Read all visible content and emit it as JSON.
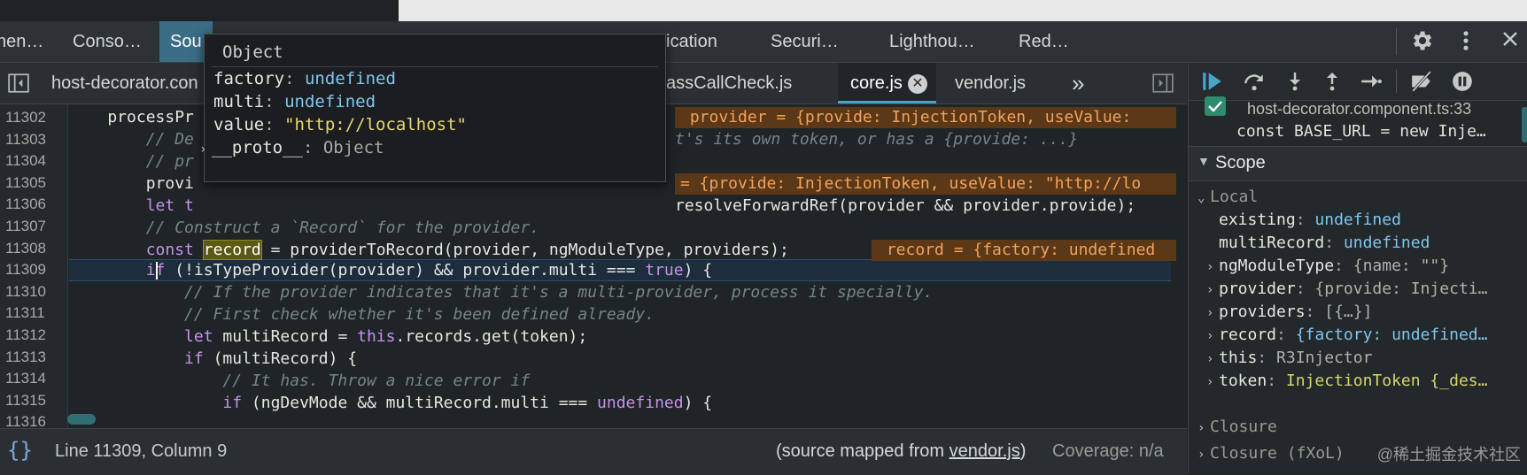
{
  "devtools_tabs": [
    "nen…",
    "Conso…",
    "Sou",
    "ication",
    "Securi…",
    "Lighthou…",
    "Red…"
  ],
  "file_tabs": {
    "left": "host-decorator.con",
    "middle": "assCallCheck.js",
    "active": "core.js",
    "next": "vendor.js",
    "more": "»"
  },
  "tooltip": {
    "title": "Object",
    "rows": [
      {
        "key": "factory",
        "value": "undefined"
      },
      {
        "key": "multi",
        "value": "undefined"
      },
      {
        "key": "value",
        "value": "\"http://localhost\""
      },
      {
        "key": "__proto__",
        "value": "Object"
      }
    ]
  },
  "code": {
    "line_numbers": [
      "11302",
      "11303",
      "11304",
      "11305",
      "11306",
      "11307",
      "11308",
      "11309",
      "11310",
      "11311",
      "11312",
      "11313",
      "11314",
      "11315",
      "11316"
    ],
    "lines": [
      {
        "kind": "plain",
        "text": "    processPr"
      },
      {
        "kind": "comment",
        "text": "        // De"
      },
      {
        "kind": "comment",
        "text": "        // pr"
      },
      {
        "kind": "plain",
        "text": "        provi"
      },
      {
        "kind": "plain",
        "text": "        let t"
      },
      {
        "kind": "comment",
        "text": "        // Construct a `Record` for the provider."
      },
      {
        "kind": "record",
        "text": ""
      },
      {
        "kind": "current",
        "text": ""
      },
      {
        "kind": "comment",
        "text": "            // If the provider indicates that it's a multi-provider, process it specially."
      },
      {
        "kind": "comment",
        "text": "            // First check whether it's been defined already."
      },
      {
        "kind": "multiRecord",
        "text": ""
      },
      {
        "kind": "ifMulti",
        "text": ""
      },
      {
        "kind": "comment",
        "text": "                // It has. Throw a nice error if"
      },
      {
        "kind": "ngDev",
        "text": ""
      }
    ],
    "inline_values": {
      "l11302": " provider = {provide: InjectionToken, useValue:",
      "l11303": "t's its own token, or has a {provide: ...}",
      "l11305": "= {provide: InjectionToken, useValue: \"http://lo",
      "l11306": "resolveForwardRef(provider && provider.provide);",
      "l11308": " record = {factory: undefined"
    },
    "line_11308": {
      "const": "const",
      "record": "record",
      "rest": " = providerToRecord(provider, ngModuleType, providers);"
    },
    "line_11309": {
      "if": "if",
      "rest1": " (!isTypeProvider(provider) && provider.multi === ",
      "true": "true",
      "rest2": ") {"
    },
    "line_11312": {
      "let": "let",
      "mid": " multiRecord = ",
      "this": "this",
      "rest": ".records.get(token);"
    },
    "line_11313": {
      "if": "if",
      "rest": " (multiRecord) {"
    },
    "line_11315": {
      "if": "if",
      "mid": " (ngDevMode && multiRecord.multi === ",
      "undef": "undefined",
      "rest": ") {"
    }
  },
  "status": {
    "position": "Line 11309, Column 9",
    "source_mapped_prefix": "(source mapped from ",
    "source_mapped_link": "vendor.js",
    "source_mapped_suffix": ")",
    "coverage": "Coverage: n/a"
  },
  "right_pane": {
    "breakpoint_file": "host-decorator.component.ts:33",
    "breakpoint_code": "const BASE_URL = new Inje…",
    "scope_title": "Scope",
    "local_title": "Local",
    "vars": [
      {
        "name": "existing",
        "value": "undefined",
        "kind": "undef",
        "expand": false
      },
      {
        "name": "multiRecord",
        "value": "undefined",
        "kind": "undef",
        "expand": false
      },
      {
        "name": "ngModuleType",
        "value": "{name: \"\"}",
        "kind": "obj",
        "expand": true
      },
      {
        "name": "provider",
        "value": "{provide: Injecti…",
        "kind": "obj",
        "expand": true
      },
      {
        "name": "providers",
        "value": "[{…}]",
        "kind": "obj",
        "expand": true
      },
      {
        "name": "record",
        "value": "{factory: undefined…",
        "kind": "mix",
        "expand": true
      },
      {
        "name": "this",
        "value": "R3Injector",
        "kind": "obj",
        "expand": true
      },
      {
        "name": "token",
        "value": "InjectionToken {_des…",
        "kind": "token",
        "expand": true
      }
    ],
    "closure": "Closure",
    "closure2": "Closure (fXoL)"
  },
  "watermark": "@稀土掘金技术社区"
}
